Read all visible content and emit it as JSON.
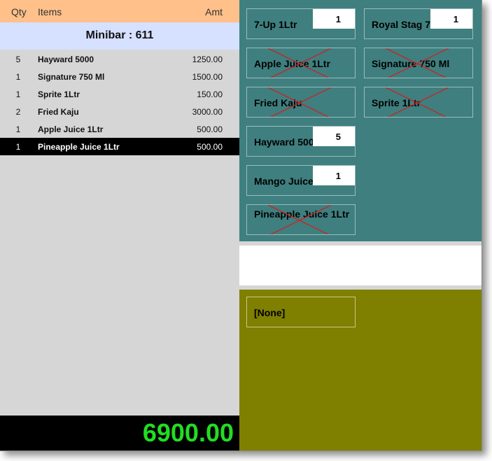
{
  "header": {
    "qty_label": "Qty",
    "items_label": "Items",
    "amt_label": "Amt"
  },
  "room_label": "Minibar : 611",
  "order_rows": [
    {
      "qty": "5",
      "name": "Hayward 5000",
      "amount": "1250.00"
    },
    {
      "qty": "1",
      "name": "Signature 750 Ml",
      "amount": "1500.00"
    },
    {
      "qty": "1",
      "name": "Sprite 1Ltr",
      "amount": "150.00"
    },
    {
      "qty": "2",
      "name": "Fried Kaju",
      "amount": "3000.00"
    },
    {
      "qty": "1",
      "name": "Apple Juice 1Ltr",
      "amount": "500.00"
    },
    {
      "qty": "1",
      "name": "Pineapple Juice 1Ltr",
      "amount": "500.00"
    }
  ],
  "total": "6900.00",
  "item_buttons": [
    {
      "label": "7-Up 1Ltr",
      "count": "1",
      "crossed": false
    },
    {
      "label": "Royal Stag 750 Ml",
      "count": "1",
      "crossed": false
    },
    {
      "label": "Apple Juice 1Ltr",
      "count": "",
      "crossed": true
    },
    {
      "label": "Signature 750 Ml",
      "count": "",
      "crossed": true
    },
    {
      "label": "Fried Kaju",
      "count": "",
      "crossed": true
    },
    {
      "label": "Sprite 1Ltr",
      "count": "",
      "crossed": true
    },
    {
      "label": "Hayward 5000",
      "count": "5",
      "crossed": false
    },
    {
      "label": "Mango Juice",
      "count": "1",
      "crossed": false
    },
    {
      "label": "Pineapple Juice 1Ltr",
      "count": "",
      "crossed": true
    }
  ],
  "modifier_button": {
    "label": "[None]"
  },
  "colors": {
    "header_bg": "#ffc08a",
    "room_bg": "#d6e0ff",
    "item_panel_bg": "#3f7f7f",
    "modifier_panel_bg": "#7f7f00",
    "total_text": "#22dd22",
    "cross_mark": "#cc2222"
  }
}
